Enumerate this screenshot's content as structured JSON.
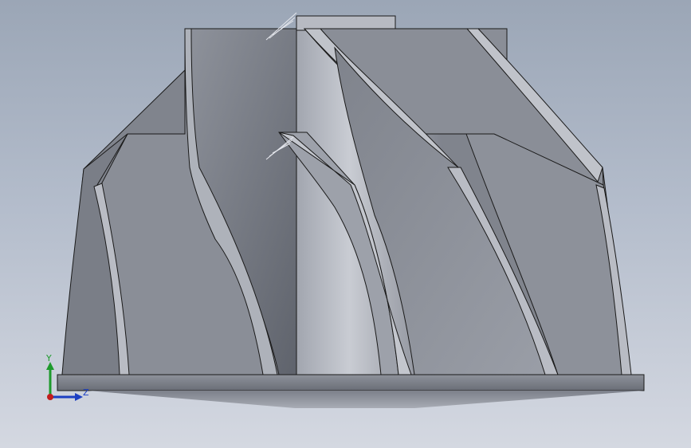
{
  "viewport": {
    "background_top": "#9ba6b6",
    "background_bottom": "#d4d8e1"
  },
  "model": {
    "description_icon": "impeller-3d-model",
    "surface_light": "#c4c7cf",
    "surface_mid": "#9a9ea8",
    "surface_dark": "#6b6f78",
    "edge_color": "#1a1a1a"
  },
  "triad": {
    "y_label": "Y",
    "z_label": "Z",
    "y_color": "#1d9a2c",
    "z_color": "#1c3fc2",
    "x_color": "#c21c1c"
  }
}
